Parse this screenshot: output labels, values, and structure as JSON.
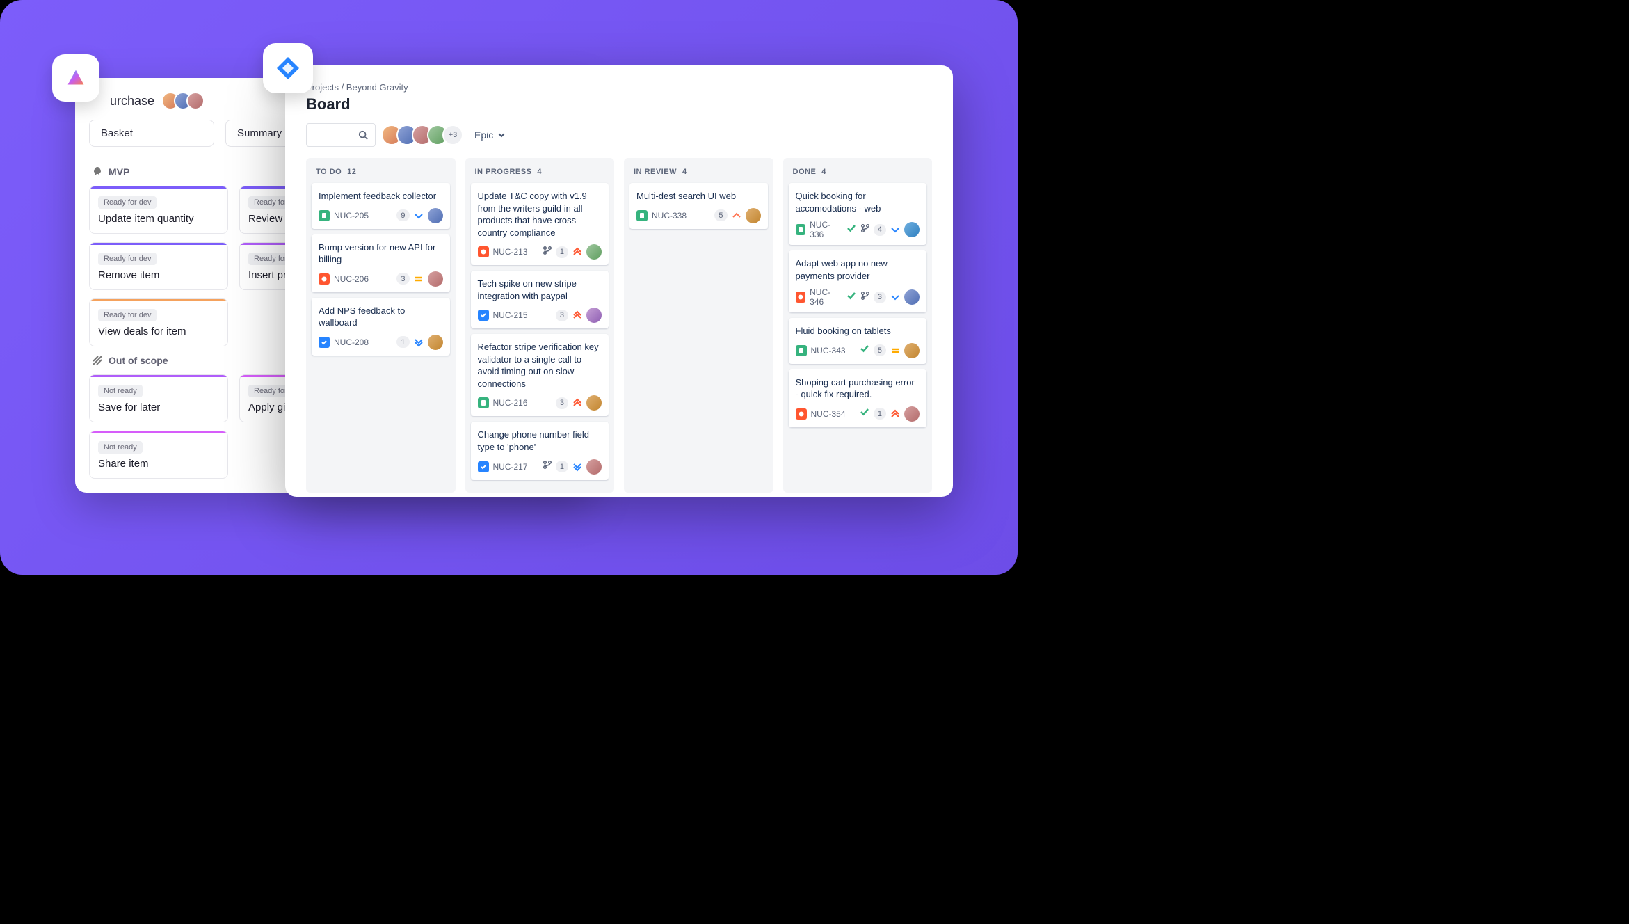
{
  "left_app": {
    "title": "urchase",
    "filters": {
      "f1": "Basket",
      "f2": "Summary"
    },
    "sections": [
      {
        "name": "MVP",
        "icon": "rocket",
        "cols": [
          [
            {
              "tag": "Ready for dev",
              "title": "Update item quantity",
              "bar": "purple"
            },
            {
              "tag": "Ready for dev",
              "title": "Remove item",
              "bar": "purple"
            },
            {
              "tag": "Ready for dev",
              "title": "View deals for item",
              "bar": "orange"
            }
          ],
          [
            {
              "tag": "Ready for dev",
              "title": "Review iter",
              "bar": "purple"
            },
            {
              "tag": "Ready for dev",
              "title": "Insert pron",
              "bar": "violet"
            }
          ]
        ]
      },
      {
        "name": "Out of scope",
        "icon": "stripes",
        "cols": [
          [
            {
              "tag": "Not ready",
              "title": "Save for later",
              "bar": "violet"
            },
            {
              "tag": "Not ready",
              "title": "Share item",
              "bar": "magenta"
            }
          ],
          [
            {
              "tag": "Ready for dev",
              "title": "Apply gift c",
              "bar": "magenta"
            }
          ]
        ]
      }
    ]
  },
  "jira": {
    "breadcrumb": "Projects / Beyond Gravity",
    "title": "Board",
    "more_avatars": "+3",
    "epic_label": "Epic",
    "columns": [
      {
        "name": "TO DO",
        "count": "12",
        "cards": [
          {
            "title": "Implement feedback collector",
            "type": "story",
            "key": "NUC-205",
            "badge": "9",
            "prio": "low",
            "av": "avc2"
          },
          {
            "title": "Bump version for new API for billing",
            "type": "bug",
            "key": "NUC-206",
            "badge": "3",
            "prio": "medium",
            "av": "avc3"
          },
          {
            "title": "Add NPS feedback to wallboard",
            "type": "task",
            "key": "NUC-208",
            "badge": "1",
            "prio": "lowest",
            "av": "avc6"
          }
        ]
      },
      {
        "name": "IN PROGRESS",
        "count": "4",
        "cards": [
          {
            "title": "Update T&C copy with v1.9 from the writers guild in all products that have cross country compliance",
            "type": "bug",
            "key": "NUC-213",
            "branch": true,
            "badge": "1",
            "prio": "highest",
            "av": "avc4"
          },
          {
            "title": "Tech spike on new stripe integration with paypal",
            "type": "task",
            "key": "NUC-215",
            "badge": "3",
            "prio": "highest",
            "av": "avc5"
          },
          {
            "title": "Refactor stripe verification key validator to a single call to avoid timing out on slow connections",
            "type": "story",
            "key": "NUC-216",
            "badge": "3",
            "prio": "highest",
            "av": "avc6"
          },
          {
            "title": "Change phone number field type to 'phone'",
            "type": "task",
            "key": "NUC-217",
            "branch": true,
            "badge": "1",
            "prio": "lowest",
            "av": "avc3"
          }
        ]
      },
      {
        "name": "IN REVIEW",
        "count": "4",
        "cards": [
          {
            "title": "Multi-dest search UI web",
            "type": "story",
            "key": "NUC-338",
            "badge": "5",
            "prio": "high",
            "av": "avc6"
          }
        ]
      },
      {
        "name": "DONE",
        "count": "4",
        "cards": [
          {
            "title": "Quick booking for accomodations - web",
            "type": "story",
            "key": "NUC-336",
            "done": true,
            "branch": true,
            "badge": "4",
            "prio": "low",
            "av": "avc7"
          },
          {
            "title": "Adapt web app no new payments provider",
            "type": "bug",
            "key": "NUC-346",
            "done": true,
            "branch": true,
            "badge": "3",
            "prio": "low",
            "av": "avc2"
          },
          {
            "title": "Fluid booking on tablets",
            "type": "story",
            "key": "NUC-343",
            "done": true,
            "badge": "5",
            "prio": "medium",
            "av": "avc6"
          },
          {
            "title": "Shoping cart purchasing error - quick fix required.",
            "type": "bug",
            "key": "NUC-354",
            "done": true,
            "badge": "1",
            "prio": "highest",
            "av": "avc3"
          }
        ]
      }
    ]
  }
}
